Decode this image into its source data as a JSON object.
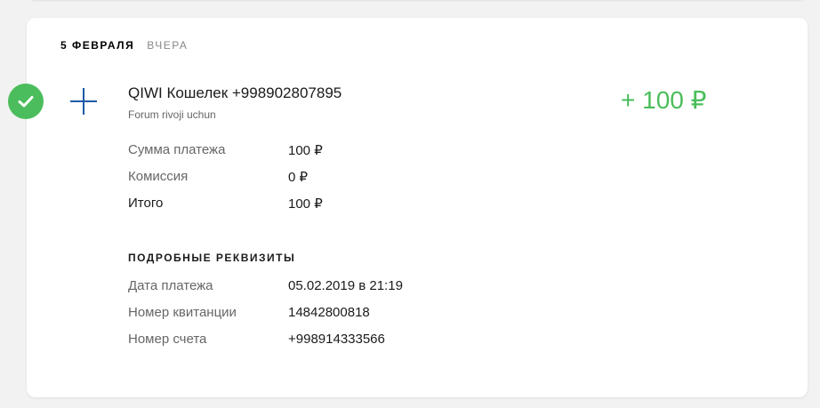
{
  "history": {
    "date_label": "5 ФЕВРАЛЯ",
    "relative_date_label": "ВЧЕРА"
  },
  "transaction": {
    "status_icon": "check-icon",
    "type_icon": "plus-icon",
    "title": "QIWI Кошелек +998902807895",
    "comment": "Forum rivoji uchun",
    "amount": "+ 100 ₽",
    "colors": {
      "success": "#4bbd5c",
      "icon": "#1e5aa8"
    },
    "summary": [
      {
        "label": "Сумма платежа",
        "value": "100 ₽"
      },
      {
        "label": "Комиссия",
        "value": "0 ₽"
      },
      {
        "label": "Итого",
        "value": "100 ₽"
      }
    ],
    "details_title": "ПОДРОБНЫЕ РЕКВИЗИТЫ",
    "details": [
      {
        "label": "Дата платежа",
        "value": "05.02.2019 в 21:19"
      },
      {
        "label": "Номер квитанции",
        "value": "14842800818"
      },
      {
        "label": "Номер счета",
        "value": "+998914333566"
      }
    ]
  }
}
